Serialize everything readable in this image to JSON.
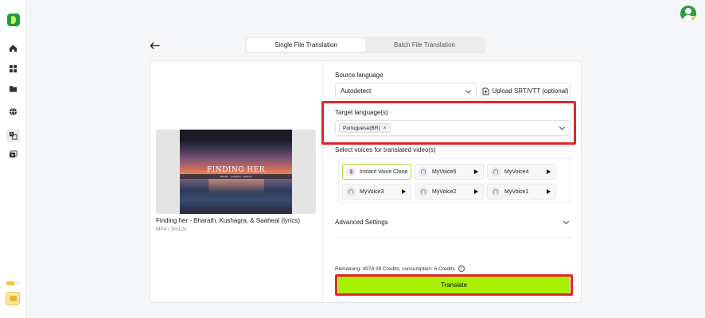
{
  "sidebar": {
    "items": [
      {
        "icon": "home-icon"
      },
      {
        "icon": "dashboard-grid-icon"
      },
      {
        "icon": "folder-icon"
      },
      {
        "icon": "globe-icon"
      },
      {
        "icon": "translate-icon",
        "active": true
      },
      {
        "icon": "video-add-icon"
      }
    ],
    "usage_color": "#f3c83a"
  },
  "header": {
    "tabs": [
      {
        "label": "Single File Translation",
        "active": true
      },
      {
        "label": "Batch File Translation",
        "active": false
      }
    ]
  },
  "video": {
    "thumbnail_title": "FINDING HER",
    "thumbnail_subtitle": "Bharath · Kushagra · Saaheal",
    "name": "Finding her - Bharath, Kushagra, & Saaheal (lyrics)",
    "meta": "MP4 / 3m12s"
  },
  "form": {
    "source_language_label": "Source language",
    "source_language_value": "Autodetect",
    "upload_label": "Upload SRT/VTT (optional)",
    "target_language_label": "Target language(s)",
    "target_languages": [
      "Portuguese(BR)"
    ],
    "voices_label": "Select voices for translated video(s)",
    "voices": [
      {
        "name": "Instant Voice Clone",
        "selected": true,
        "playable": false
      },
      {
        "name": "MyVoice5",
        "selected": false,
        "playable": true
      },
      {
        "name": "MyVoice4",
        "selected": false,
        "playable": true
      },
      {
        "name": "MyVoice3",
        "selected": false,
        "playable": true
      },
      {
        "name": "MyVoice2",
        "selected": false,
        "playable": true
      },
      {
        "name": "MyVoice1",
        "selected": false,
        "playable": true
      }
    ],
    "advanced_label": "Advanced Settings",
    "credits_text": "Remaining: 4978.39 Credits; consumption: 6 Credits",
    "translate_label": "Translate"
  },
  "colors": {
    "accent": "#a6f000",
    "highlight": "#e0262a",
    "brand": "#1f9e3a"
  }
}
